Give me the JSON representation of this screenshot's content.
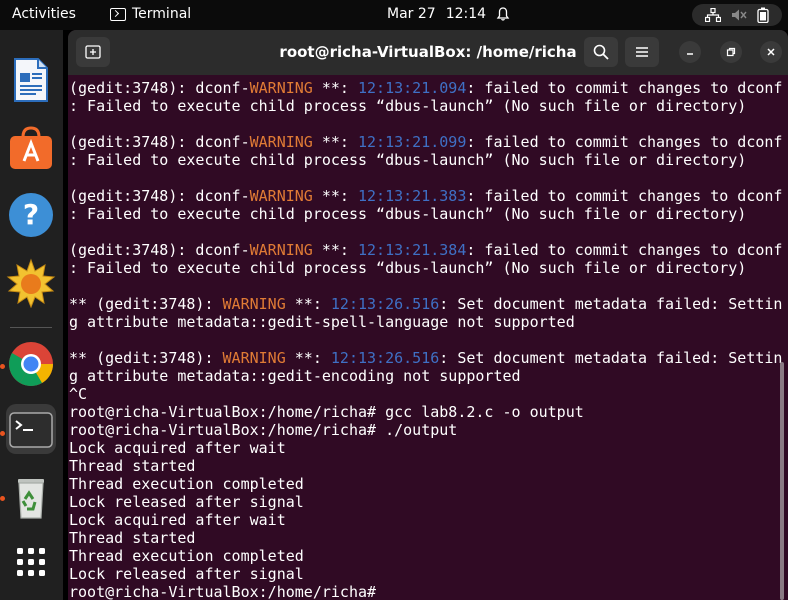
{
  "topbar": {
    "activities": "Activities",
    "app_name": "Terminal",
    "date": "Mar 27",
    "time": "12:14"
  },
  "window": {
    "title": "root@richa-VirtualBox: /home/richa"
  },
  "terminal": {
    "lines": [
      {
        "segs": [
          {
            "t": "(gedit:3748): dconf-"
          },
          {
            "t": "WARNING",
            "c": "warn"
          },
          {
            "t": " **: "
          },
          {
            "t": "12:13:21.094",
            "c": "ts"
          },
          {
            "t": ": failed to commit changes to dconf"
          }
        ]
      },
      {
        "segs": [
          {
            "t": ": Failed to execute child process “dbus-launch” (No such file or directory)"
          }
        ]
      },
      {
        "segs": []
      },
      {
        "segs": [
          {
            "t": "(gedit:3748): dconf-"
          },
          {
            "t": "WARNING",
            "c": "warn"
          },
          {
            "t": " **: "
          },
          {
            "t": "12:13:21.099",
            "c": "ts"
          },
          {
            "t": ": failed to commit changes to dconf"
          }
        ]
      },
      {
        "segs": [
          {
            "t": ": Failed to execute child process “dbus-launch” (No such file or directory)"
          }
        ]
      },
      {
        "segs": []
      },
      {
        "segs": [
          {
            "t": "(gedit:3748): dconf-"
          },
          {
            "t": "WARNING",
            "c": "warn"
          },
          {
            "t": " **: "
          },
          {
            "t": "12:13:21.383",
            "c": "ts"
          },
          {
            "t": ": failed to commit changes to dconf"
          }
        ]
      },
      {
        "segs": [
          {
            "t": ": Failed to execute child process “dbus-launch” (No such file or directory)"
          }
        ]
      },
      {
        "segs": []
      },
      {
        "segs": [
          {
            "t": "(gedit:3748): dconf-"
          },
          {
            "t": "WARNING",
            "c": "warn"
          },
          {
            "t": " **: "
          },
          {
            "t": "12:13:21.384",
            "c": "ts"
          },
          {
            "t": ": failed to commit changes to dconf"
          }
        ]
      },
      {
        "segs": [
          {
            "t": ": Failed to execute child process “dbus-launch” (No such file or directory)"
          }
        ]
      },
      {
        "segs": []
      },
      {
        "segs": [
          {
            "t": "** (gedit:3748): "
          },
          {
            "t": "WARNING",
            "c": "warn"
          },
          {
            "t": " **: "
          },
          {
            "t": "12:13:26.516",
            "c": "ts"
          },
          {
            "t": ": Set document metadata failed: Settin"
          }
        ]
      },
      {
        "segs": [
          {
            "t": "g attribute metadata::gedit-spell-language not supported"
          }
        ]
      },
      {
        "segs": []
      },
      {
        "segs": [
          {
            "t": "** (gedit:3748): "
          },
          {
            "t": "WARNING",
            "c": "warn"
          },
          {
            "t": " **: "
          },
          {
            "t": "12:13:26.516",
            "c": "ts"
          },
          {
            "t": ": Set document metadata failed: Settin"
          }
        ]
      },
      {
        "segs": [
          {
            "t": "g attribute metadata::gedit-encoding not supported"
          }
        ]
      },
      {
        "segs": [
          {
            "t": "^C"
          }
        ]
      },
      {
        "segs": [
          {
            "t": "root@richa-VirtualBox:/home/richa# gcc lab8.2.c -o output"
          }
        ]
      },
      {
        "segs": [
          {
            "t": "root@richa-VirtualBox:/home/richa# ./output"
          }
        ]
      },
      {
        "segs": [
          {
            "t": "Lock acquired after wait"
          }
        ]
      },
      {
        "segs": [
          {
            "t": "Thread started"
          }
        ]
      },
      {
        "segs": [
          {
            "t": "Thread execution completed"
          }
        ]
      },
      {
        "segs": [
          {
            "t": "Lock released after signal"
          }
        ]
      },
      {
        "segs": [
          {
            "t": "Lock acquired after wait"
          }
        ]
      },
      {
        "segs": [
          {
            "t": "Thread started"
          }
        ]
      },
      {
        "segs": [
          {
            "t": "Thread execution completed"
          }
        ]
      },
      {
        "segs": [
          {
            "t": "Lock released after signal"
          }
        ]
      },
      {
        "segs": [
          {
            "t": "root@richa-VirtualBox:/home/richa# "
          }
        ]
      }
    ]
  },
  "colors": {
    "terminal_bg": "#300a24",
    "warning": "#e07b35",
    "timestamp": "#3f70c5",
    "accent": "#e9541f"
  }
}
